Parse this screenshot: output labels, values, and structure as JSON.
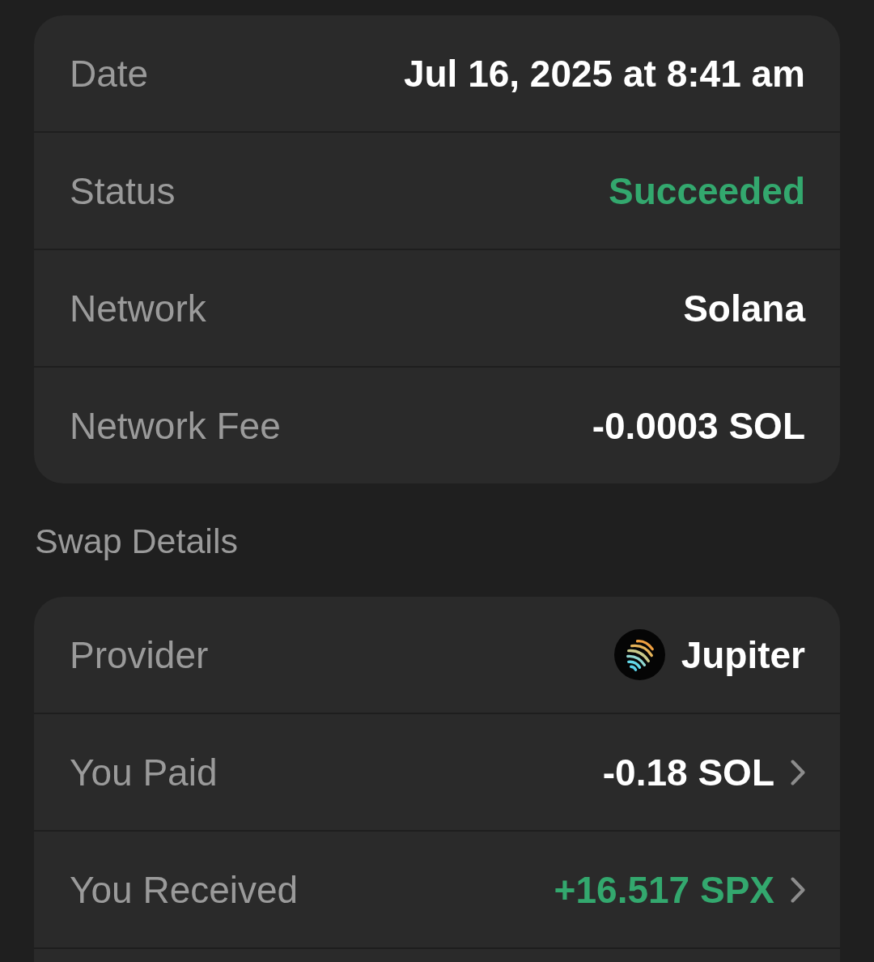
{
  "details": [
    {
      "label": "Date",
      "value": "Jul 16, 2025 at 8:41 am",
      "kind": "plain",
      "color": "#ffffff"
    },
    {
      "label": "Status",
      "value": "Succeeded",
      "kind": "plain",
      "color": "#33a86e"
    },
    {
      "label": "Network",
      "value": "Solana",
      "kind": "plain",
      "color": "#ffffff"
    },
    {
      "label": "Network Fee",
      "value": "-0.0003 SOL",
      "kind": "plain",
      "color": "#ffffff"
    }
  ],
  "swap_details": {
    "heading": "Swap Details",
    "rows": [
      {
        "label": "Provider",
        "value": "Jupiter",
        "kind": "provider",
        "color": "#ffffff"
      },
      {
        "label": "You Paid",
        "value": "-0.18 SOL",
        "kind": "link",
        "color": "#ffffff"
      },
      {
        "label": "You Received",
        "value": "+16.517 SPX",
        "kind": "link",
        "color": "#33a86e"
      }
    ]
  }
}
